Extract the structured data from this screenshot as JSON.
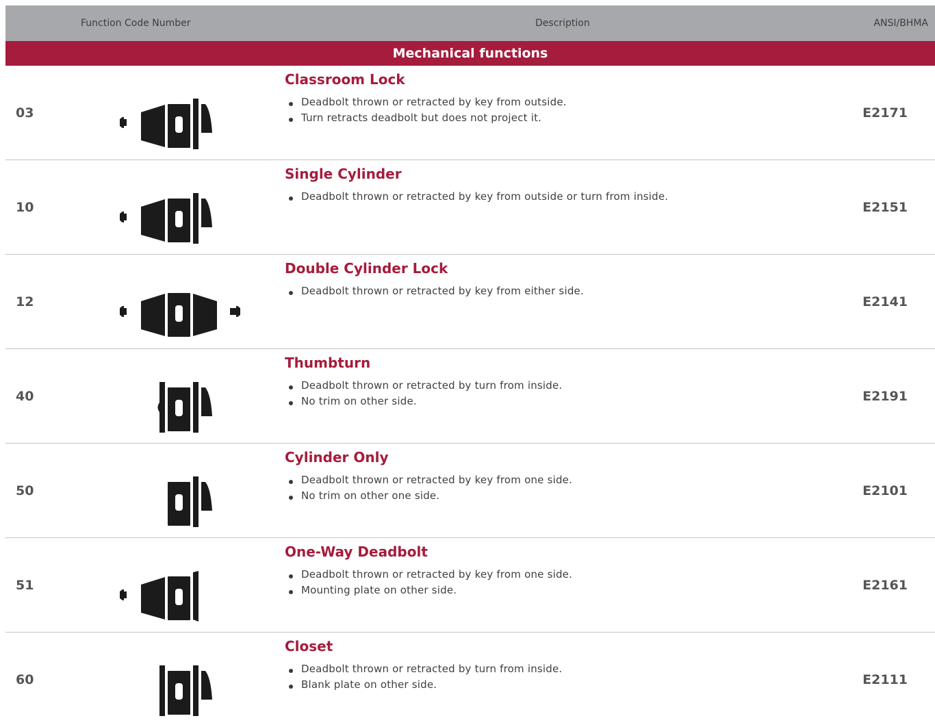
{
  "header": {
    "code_label": "Function Code Number",
    "description_label": "Description",
    "ansi_label": "ANSI/BHMA"
  },
  "section": {
    "title": "Mechanical functions"
  },
  "rows": [
    {
      "code": "03",
      "title": "Classroom Lock",
      "bullets": [
        "Deadbolt thrown or retracted by key from outside.",
        "Turn retracts deadbolt but does not project it."
      ],
      "ansi": "E2171",
      "icon": "classroom-lock-icon"
    },
    {
      "code": "10",
      "title": "Single Cylinder",
      "bullets": [
        "Deadbolt thrown or retracted by key from outside or turn from inside."
      ],
      "ansi": "E2151",
      "icon": "single-cylinder-icon"
    },
    {
      "code": "12",
      "title": "Double Cylinder Lock",
      "bullets": [
        "Deadbolt thrown or retracted by key from either side."
      ],
      "ansi": "E2141",
      "icon": "double-cylinder-icon"
    },
    {
      "code": "40",
      "title": "Thumbturn",
      "bullets": [
        "Deadbolt thrown or retracted by turn from inside.",
        "No trim on other side."
      ],
      "ansi": "E2191",
      "icon": "thumbturn-icon"
    },
    {
      "code": "50",
      "title": "Cylinder Only",
      "bullets": [
        "Deadbolt thrown or retracted by key from one side.",
        "No trim on other one side."
      ],
      "ansi": "E2101",
      "icon": "cylinder-only-icon"
    },
    {
      "code": "51",
      "title": "One-Way Deadbolt",
      "bullets": [
        "Deadbolt thrown or retracted by key from one side.",
        "Mounting plate on other side."
      ],
      "ansi": "E2161",
      "icon": "one-way-deadbolt-icon"
    },
    {
      "code": "60",
      "title": "Closet",
      "bullets": [
        "Deadbolt thrown or retracted by turn from inside.",
        "Blank plate on other side."
      ],
      "ansi": "E2111",
      "icon": "closet-icon"
    }
  ]
}
